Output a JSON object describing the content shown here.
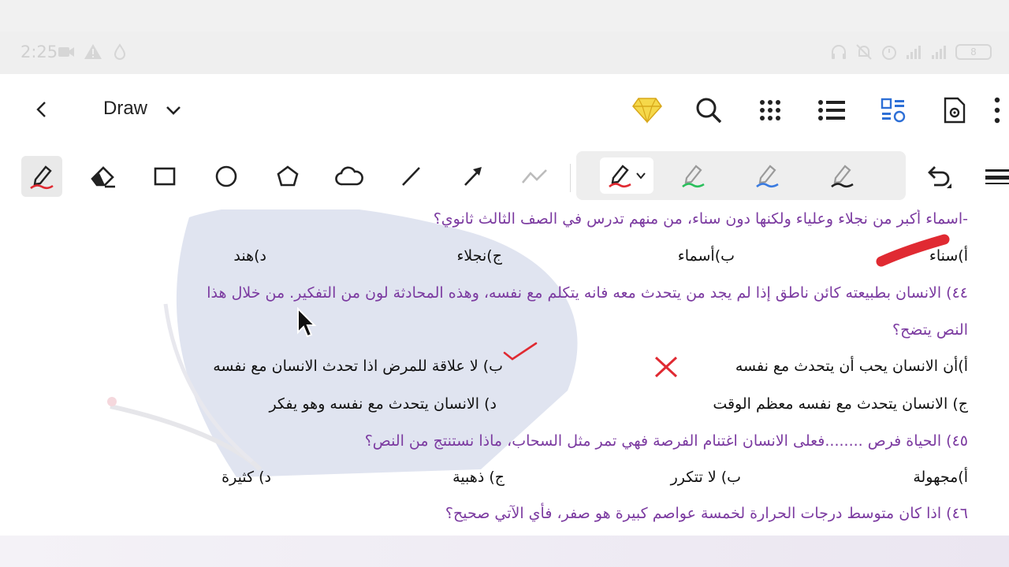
{
  "status": {
    "time": "2:25",
    "battery": "8"
  },
  "topbar": {
    "mode_title": "Draw"
  },
  "document": {
    "q43": "-اسماء أكبر من نجلاء وعلياء ولكنها دون سناء، من منهم تدرس في الصف الثالث ثانوي؟",
    "q43_options": [
      "أ)سناء",
      "ب)أسماء",
      "ج)نجلاء",
      "د)هند"
    ],
    "q44_line1": "٤٤) الانسان بطبيعته كائن ناطق إذا لم يجد من يتحدث معه فانه يتكلم مع نفسه، وهذه المحادثة لون من التفكير. من خلال هذا",
    "q44_line2": "النص يتضح؟",
    "q44_options": [
      "أ)أن الانسان يحب أن يتحدث مع نفسه",
      "ب) لا علاقة للمرض اذا تحدث الانسان مع نفسه",
      "ج) الانسان يتحدث مع نفسه معظم الوقت",
      "د) الانسان يتحدث مع نفسه وهو يفكر"
    ],
    "q45": "٤٥) الحياة فرص ........فعلى الانسان اغتنام الفرصة فهي تمر مثل السحاب، ماذا نستنتج من النص؟",
    "q45_options": [
      "أ)مجهولة",
      "ب) لا تتكرر",
      "ج) ذهبية",
      "د) كثيرة"
    ],
    "q46": "٤٦) اذا كان متوسط درجات الحرارة لخمسة عواصم كبيرة هو صفر، فأي الآتي صحيح؟"
  },
  "colors": {
    "question": "#7b3aa0",
    "answer": "#111111",
    "annotation_red": "#e02a32",
    "premium_gold": "#e8c52a",
    "accent_blue": "#2d6fd6",
    "pen_green": "#2bbf5c"
  }
}
